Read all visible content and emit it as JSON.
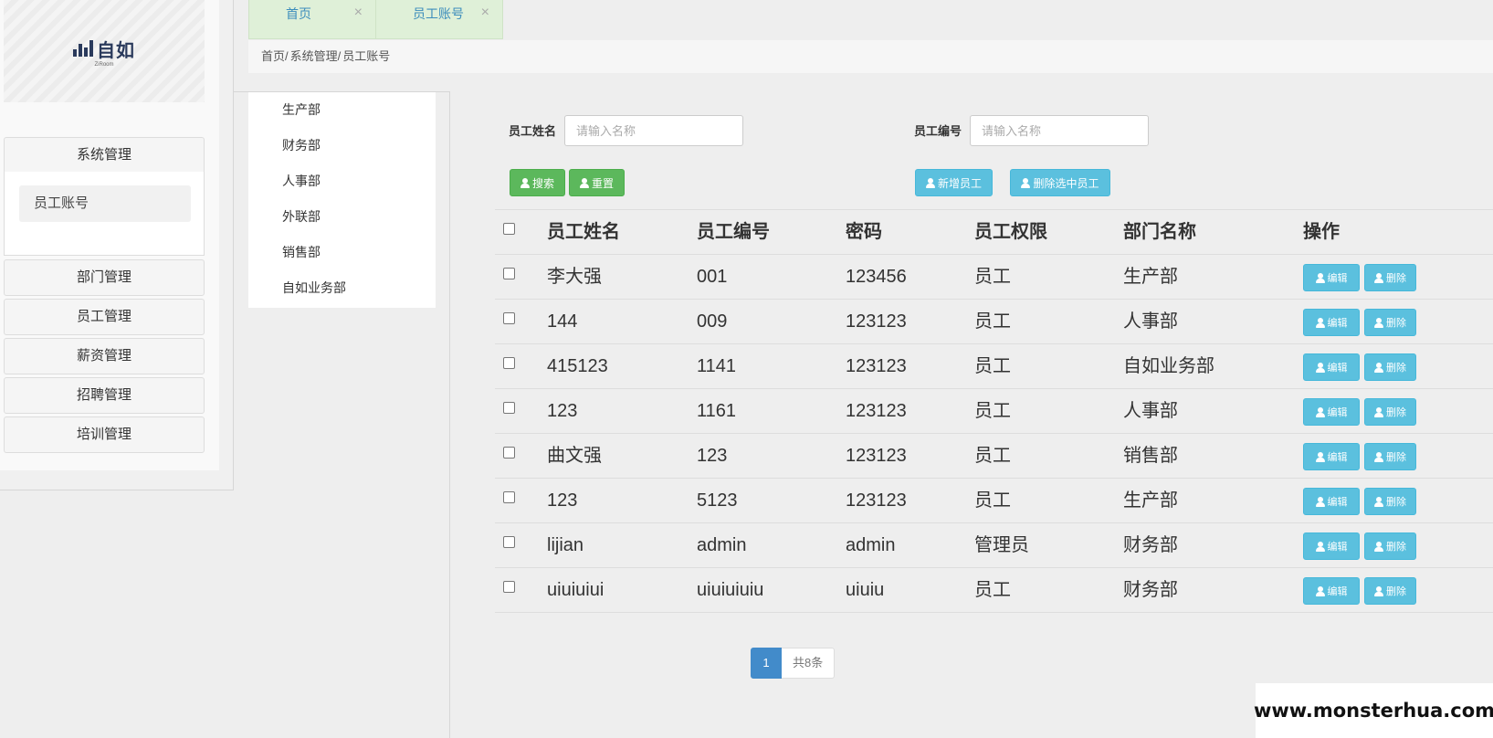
{
  "logo": {
    "text": "自如",
    "sub": "ZiRoom"
  },
  "sidebar": {
    "open_group": {
      "label": "系统管理",
      "items": [
        {
          "label": "员工账号"
        }
      ]
    },
    "groups": [
      {
        "label": "部门管理"
      },
      {
        "label": "员工管理"
      },
      {
        "label": "薪资管理"
      },
      {
        "label": "招聘管理"
      },
      {
        "label": "培训管理"
      }
    ]
  },
  "tabs": [
    {
      "label": "首页",
      "close": "×"
    },
    {
      "label": "员工账号",
      "close": "×"
    }
  ],
  "breadcrumb": [
    "首页/",
    "系统管理/",
    "员工账号"
  ],
  "departments": [
    "生产部",
    "财务部",
    "人事部",
    "外联部",
    "销售部",
    "自如业务部"
  ],
  "search": {
    "name_label": "员工姓名",
    "name_placeholder": "请输入名称",
    "no_label": "员工编号",
    "no_placeholder": "请输入名称",
    "search_button": "搜索",
    "reset_button": "重置",
    "add_button": "新增员工",
    "delete_selected_button": "删除选中员工"
  },
  "table": {
    "headers": {
      "name": "员工姓名",
      "no": "员工编号",
      "pwd": "密码",
      "role": "员工权限",
      "dept": "部门名称",
      "op": "操作"
    },
    "edit_label": "编辑",
    "delete_label": "删除",
    "rows": [
      {
        "name": "李大强",
        "no": "001",
        "pwd": "123456",
        "role": "员工",
        "dept": "生产部"
      },
      {
        "name": "144",
        "no": "009",
        "pwd": "123123",
        "role": "员工",
        "dept": "人事部"
      },
      {
        "name": "415123",
        "no": "1141",
        "pwd": "123123",
        "role": "员工",
        "dept": "自如业务部"
      },
      {
        "name": "123",
        "no": "1161",
        "pwd": "123123",
        "role": "员工",
        "dept": "人事部"
      },
      {
        "name": "曲文强",
        "no": "123",
        "pwd": "123123",
        "role": "员工",
        "dept": "销售部"
      },
      {
        "name": "123",
        "no": "5123",
        "pwd": "123123",
        "role": "员工",
        "dept": "生产部"
      },
      {
        "name": "lijian",
        "no": "admin",
        "pwd": "admin",
        "role": "管理员",
        "dept": "财务部"
      },
      {
        "name": "uiuiuiui",
        "no": "uiuiuiuiu",
        "pwd": "uiuiu",
        "role": "员工",
        "dept": "财务部"
      }
    ]
  },
  "pagination": {
    "current": "1",
    "total": "共8条"
  },
  "watermark": "www.monsterhua.com"
}
